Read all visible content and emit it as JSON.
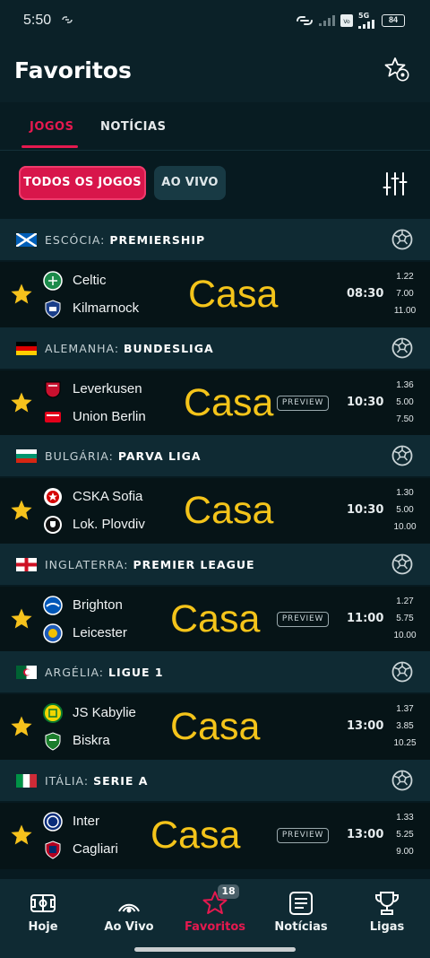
{
  "status_bar": {
    "time": "5:50",
    "battery": "84",
    "network": "5G"
  },
  "header": {
    "title": "Favoritos",
    "settings_icon": "star-gear-icon"
  },
  "tabs": [
    {
      "label": "JOGOS",
      "active": true
    },
    {
      "label": "NOTÍCIAS",
      "active": false
    }
  ],
  "filters": {
    "all_label": "TODOS OS JOGOS",
    "live_label": "AO VIVO",
    "filter_icon": "sliders-icon"
  },
  "overlay_word": "Casa",
  "leagues": [
    {
      "country": "ESCÓCIA:",
      "name": "PREMIERSHIP",
      "flag": "scotland",
      "match": {
        "home": "Celtic",
        "away": "Kilmarnock",
        "time": "08:30",
        "preview": "",
        "odds": [
          "1.22",
          "7.00",
          "11.00"
        ]
      }
    },
    {
      "country": "ALEMANHA:",
      "name": "BUNDESLIGA",
      "flag": "germany",
      "match": {
        "home": "Leverkusen",
        "away": "Union Berlin",
        "time": "10:30",
        "preview": "PREVIEW",
        "odds": [
          "1.36",
          "5.00",
          "7.50"
        ]
      }
    },
    {
      "country": "BULGÁRIA:",
      "name": "PARVA LIGA",
      "flag": "bulgaria",
      "match": {
        "home": "CSKA Sofia",
        "away": "Lok. Plovdiv",
        "time": "10:30",
        "preview": "",
        "odds": [
          "1.30",
          "5.00",
          "10.00"
        ]
      }
    },
    {
      "country": "INGLATERRA:",
      "name": "PREMIER LEAGUE",
      "flag": "england",
      "match": {
        "home": "Brighton",
        "away": "Leicester",
        "time": "11:00",
        "preview": "PREVIEW",
        "odds": [
          "1.27",
          "5.75",
          "10.00"
        ]
      }
    },
    {
      "country": "ARGÉLIA:",
      "name": "LIGUE 1",
      "flag": "algeria",
      "match": {
        "home": "JS Kabylie",
        "away": "Biskra",
        "time": "13:00",
        "preview": "",
        "odds": [
          "1.37",
          "3.85",
          "10.25"
        ]
      }
    },
    {
      "country": "ITÁLIA:",
      "name": "SERIE A",
      "flag": "italy",
      "match": {
        "home": "Inter",
        "away": "Cagliari",
        "time": "13:00",
        "preview": "PREVIEW",
        "odds": [
          "1.33",
          "5.25",
          "9.00"
        ]
      }
    }
  ],
  "bottom_nav": [
    {
      "label": "Hoje",
      "icon": "pitch-icon",
      "active": false
    },
    {
      "label": "Ao Vivo",
      "icon": "broadcast-icon",
      "active": false
    },
    {
      "label": "Favoritos",
      "icon": "star-icon",
      "active": true,
      "badge": "18"
    },
    {
      "label": "Notícias",
      "icon": "news-icon",
      "active": false
    },
    {
      "label": "Ligas",
      "icon": "trophy-icon",
      "active": false
    }
  ],
  "colors": {
    "accent": "#e5194f",
    "star": "#f6c21c",
    "overlay": "#f4c41a",
    "background": "#071a20"
  }
}
